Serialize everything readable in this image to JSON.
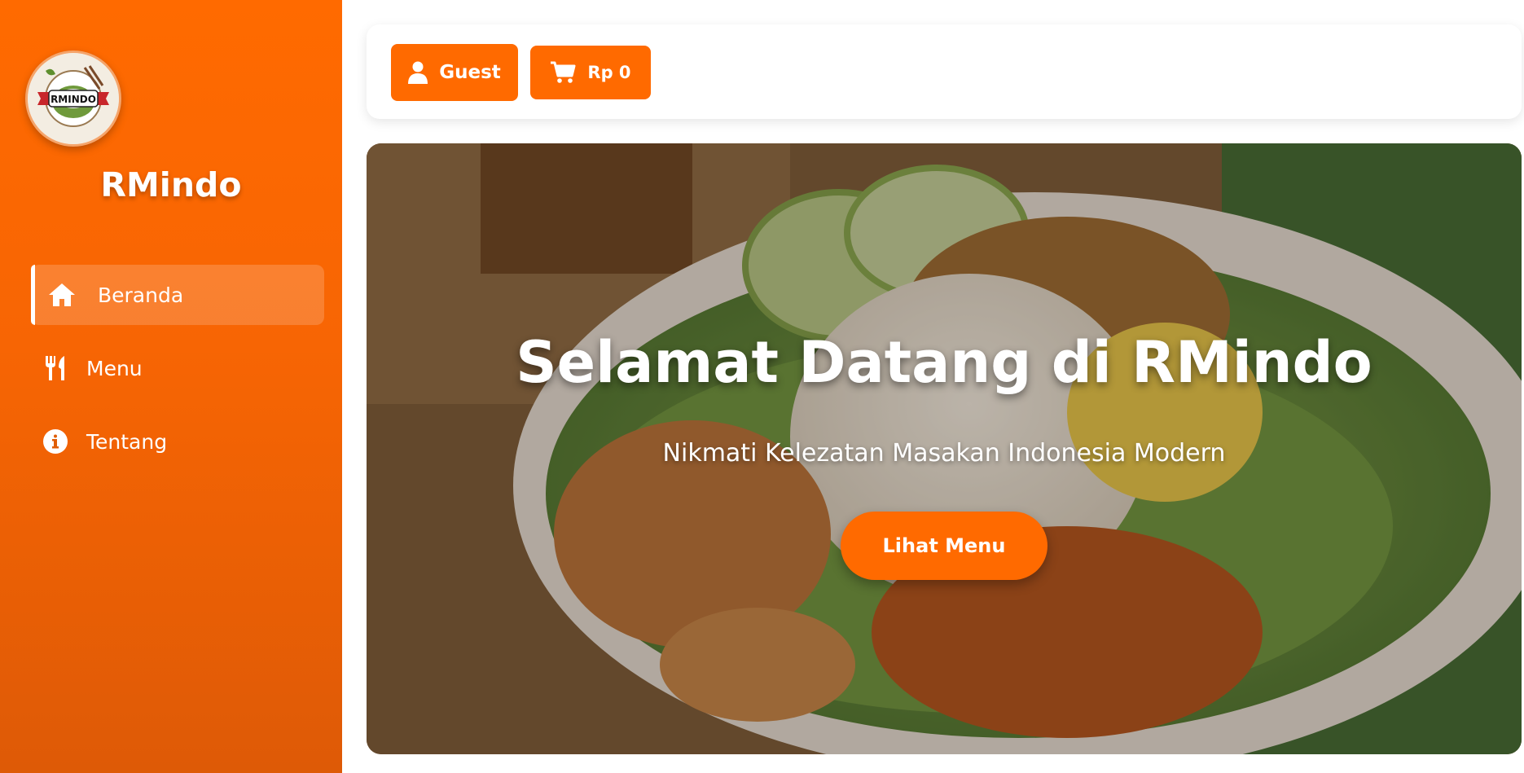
{
  "sidebar": {
    "brand": "RMindo",
    "logo_text": "RMINDO",
    "items": [
      {
        "label": "Beranda",
        "icon": "home-icon",
        "active": true
      },
      {
        "label": "Menu",
        "icon": "utensils-icon",
        "active": false
      },
      {
        "label": "Tentang",
        "icon": "info-icon",
        "active": false
      }
    ]
  },
  "topbar": {
    "user_label": "Guest",
    "user_icon": "user-icon",
    "cart_label": "Rp 0",
    "cart_icon": "cart-icon"
  },
  "hero": {
    "title": "Selamat Datang di RMindo",
    "subtitle": "Nikmati Kelezatan Masakan Indonesia Modern",
    "cta_label": "Lihat Menu",
    "image": "nasi-uduk-fried-chicken-photo"
  },
  "colors": {
    "accent": "#ff6a00",
    "sidebar_bottom": "#de5a06",
    "text_on_accent": "#ffffff"
  }
}
